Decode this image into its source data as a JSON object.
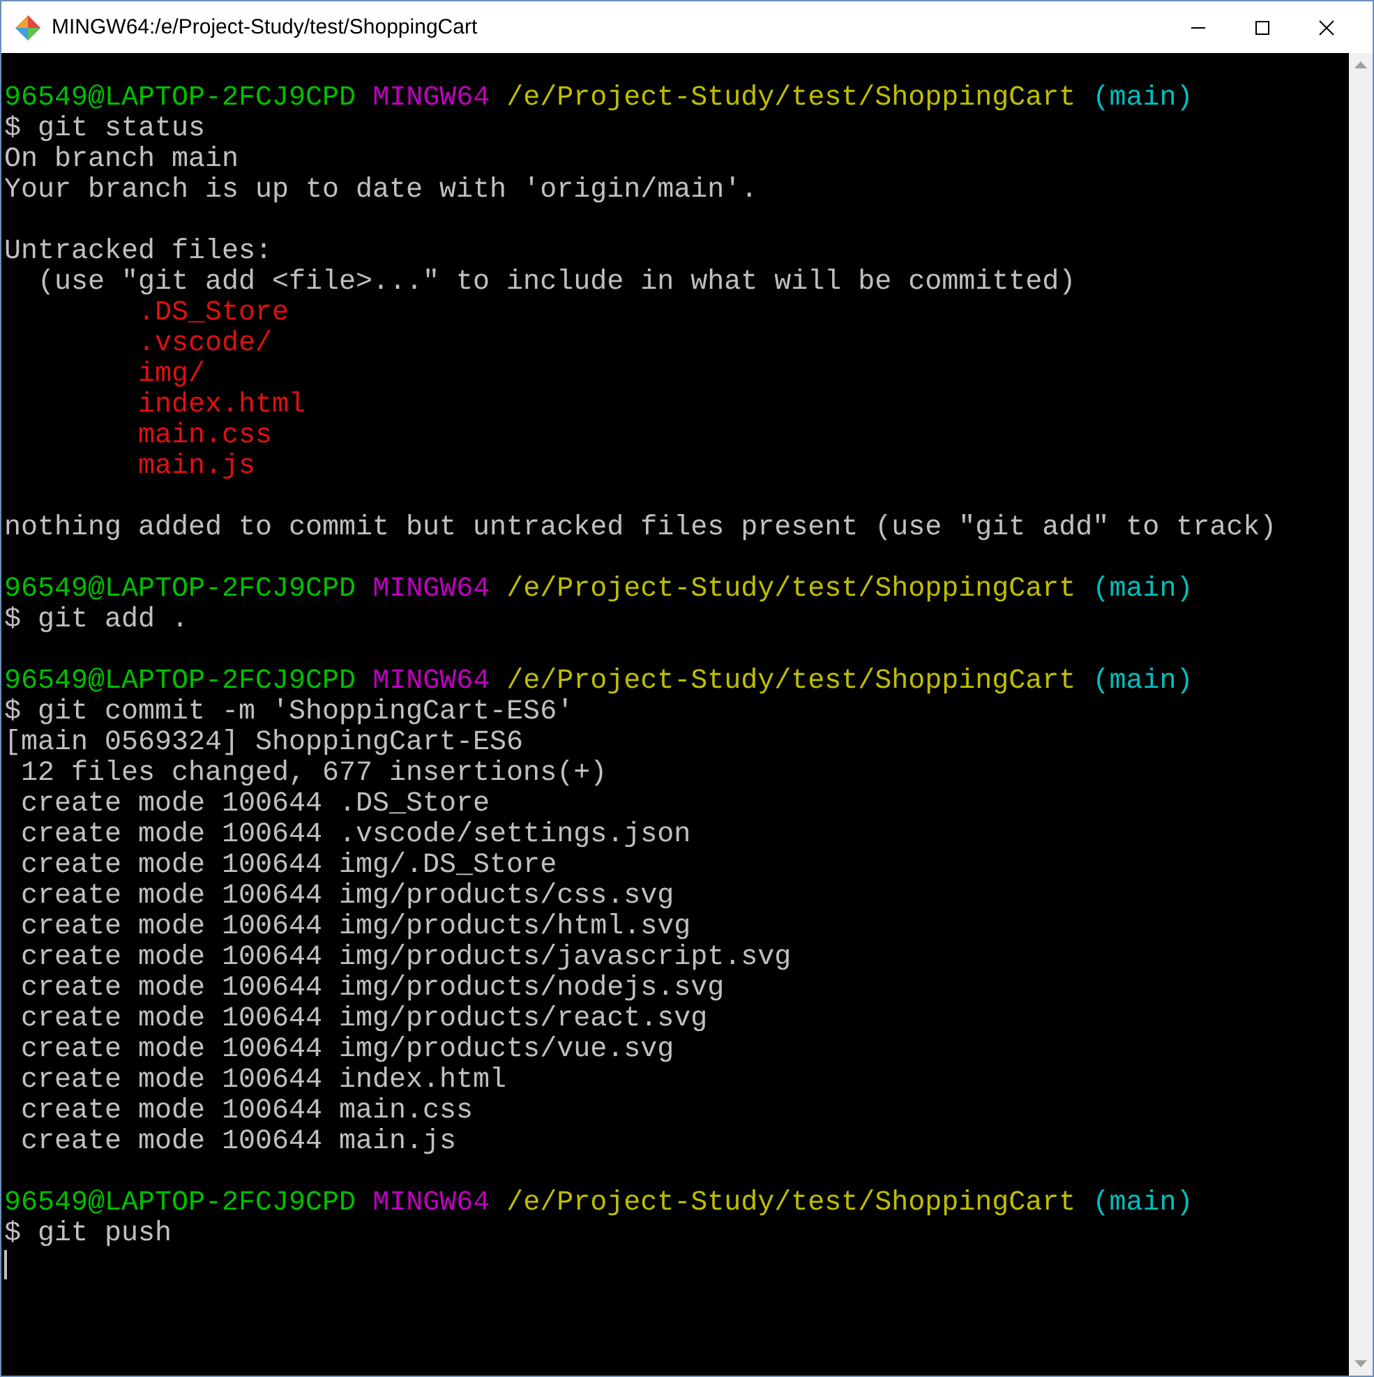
{
  "window": {
    "title": "MINGW64:/e/Project-Study/test/ShoppingCart"
  },
  "lines": [
    {
      "kind": "prompt",
      "user": "96549@LAPTOP-2FCJ9CPD",
      "shell": "MINGW64",
      "path": "/e/Project-Study/test/ShoppingCart",
      "branch": "(main)"
    },
    {
      "kind": "command",
      "text": "$ git status"
    },
    {
      "kind": "output",
      "text": "On branch main"
    },
    {
      "kind": "output",
      "text": "Your branch is up to date with 'origin/main'."
    },
    {
      "kind": "blank"
    },
    {
      "kind": "output",
      "text": "Untracked files:"
    },
    {
      "kind": "output",
      "text": "  (use \"git add <file>...\" to include in what will be committed)"
    },
    {
      "kind": "untracked",
      "text": "        .DS_Store"
    },
    {
      "kind": "untracked",
      "text": "        .vscode/"
    },
    {
      "kind": "untracked",
      "text": "        img/"
    },
    {
      "kind": "untracked",
      "text": "        index.html"
    },
    {
      "kind": "untracked",
      "text": "        main.css"
    },
    {
      "kind": "untracked",
      "text": "        main.js"
    },
    {
      "kind": "blank"
    },
    {
      "kind": "output",
      "text": "nothing added to commit but untracked files present (use \"git add\" to track)"
    },
    {
      "kind": "blank"
    },
    {
      "kind": "prompt",
      "user": "96549@LAPTOP-2FCJ9CPD",
      "shell": "MINGW64",
      "path": "/e/Project-Study/test/ShoppingCart",
      "branch": "(main)"
    },
    {
      "kind": "command",
      "text": "$ git add ."
    },
    {
      "kind": "blank"
    },
    {
      "kind": "prompt",
      "user": "96549@LAPTOP-2FCJ9CPD",
      "shell": "MINGW64",
      "path": "/e/Project-Study/test/ShoppingCart",
      "branch": "(main)"
    },
    {
      "kind": "command",
      "text": "$ git commit -m 'ShoppingCart-ES6'"
    },
    {
      "kind": "output",
      "text": "[main 0569324] ShoppingCart-ES6"
    },
    {
      "kind": "output",
      "text": " 12 files changed, 677 insertions(+)"
    },
    {
      "kind": "output",
      "text": " create mode 100644 .DS_Store"
    },
    {
      "kind": "output",
      "text": " create mode 100644 .vscode/settings.json"
    },
    {
      "kind": "output",
      "text": " create mode 100644 img/.DS_Store"
    },
    {
      "kind": "output",
      "text": " create mode 100644 img/products/css.svg"
    },
    {
      "kind": "output",
      "text": " create mode 100644 img/products/html.svg"
    },
    {
      "kind": "output",
      "text": " create mode 100644 img/products/javascript.svg"
    },
    {
      "kind": "output",
      "text": " create mode 100644 img/products/nodejs.svg"
    },
    {
      "kind": "output",
      "text": " create mode 100644 img/products/react.svg"
    },
    {
      "kind": "output",
      "text": " create mode 100644 img/products/vue.svg"
    },
    {
      "kind": "output",
      "text": " create mode 100644 index.html"
    },
    {
      "kind": "output",
      "text": " create mode 100644 main.css"
    },
    {
      "kind": "output",
      "text": " create mode 100644 main.js"
    },
    {
      "kind": "blank"
    },
    {
      "kind": "prompt",
      "user": "96549@LAPTOP-2FCJ9CPD",
      "shell": "MINGW64",
      "path": "/e/Project-Study/test/ShoppingCart",
      "branch": "(main)"
    },
    {
      "kind": "command",
      "text": "$ git push"
    },
    {
      "kind": "cursor"
    }
  ]
}
